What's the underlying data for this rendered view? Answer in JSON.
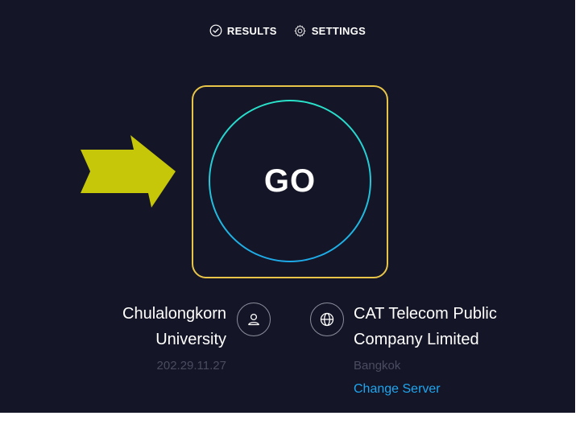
{
  "nav": {
    "results_label": "RESULTS",
    "settings_label": "SETTINGS"
  },
  "go_button": {
    "label": "GO"
  },
  "isp": {
    "name_line1": "Chulalongkorn",
    "name_line2": "University",
    "ip": "202.29.11.27"
  },
  "server": {
    "name_line1": "CAT Telecom Public",
    "name_line2": "Company Limited",
    "location": "Bangkok",
    "change_label": "Change Server"
  },
  "colors": {
    "background": "#141526",
    "highlight_border": "#e8c548",
    "ring_top": "#2ae3c9",
    "ring_bottom": "#1ea9e8",
    "arrow": "#c7c70a",
    "link": "#1fa6f0",
    "muted_text": "#4a4c60"
  },
  "icons": {
    "results": "check-circle-icon",
    "settings": "gear-icon",
    "isp": "user-icon",
    "server": "globe-icon",
    "annotation": "arrow-right-icon"
  }
}
